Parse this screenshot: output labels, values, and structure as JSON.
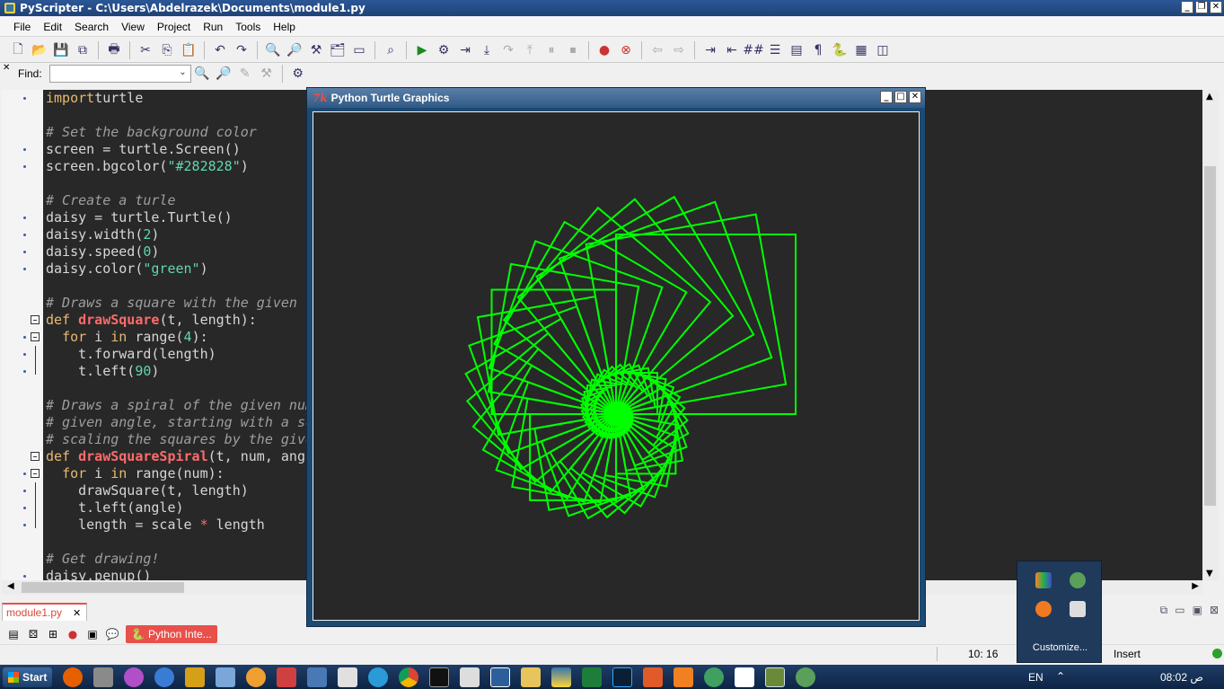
{
  "window": {
    "title": "PyScripter - C:\\Users\\Abdelrazek\\Documents\\module1.py"
  },
  "menu": [
    "File",
    "Edit",
    "Search",
    "View",
    "Project",
    "Run",
    "Tools",
    "Help"
  ],
  "findbar": {
    "label": "Find:",
    "value": ""
  },
  "editor": {
    "lines": [
      [
        [
          "imp",
          "import"
        ],
        [
          "",
          "turtle"
        ]
      ],
      [],
      [
        [
          "cm",
          "# Set the background color"
        ]
      ],
      [
        [
          "",
          "screen = turtle.Screen()"
        ]
      ],
      [
        [
          "",
          "screen.bgcolor("
        ],
        [
          "st",
          "\"#282828\""
        ],
        [
          "",
          ")"
        ]
      ],
      [],
      [
        [
          "cm",
          "# Create a turle"
        ]
      ],
      [
        [
          "",
          "daisy = turtle.Turtle()"
        ]
      ],
      [
        [
          "",
          "daisy.width("
        ],
        [
          "nm",
          "2"
        ],
        [
          "",
          ")"
        ]
      ],
      [
        [
          "",
          "daisy.speed("
        ],
        [
          "nm",
          "0"
        ],
        [
          "",
          ")"
        ]
      ],
      [
        [
          "",
          "daisy.color("
        ],
        [
          "st",
          "\"green\""
        ],
        [
          "",
          ")"
        ]
      ],
      [],
      [
        [
          "cm",
          "# Draws a square with the given l"
        ]
      ],
      [
        [
          "kw",
          "def"
        ],
        [
          "",
          " "
        ],
        [
          "fn",
          "drawSquare"
        ],
        [
          "",
          "(t, length):"
        ]
      ],
      [
        [
          "",
          "  "
        ],
        [
          "kw",
          "for"
        ],
        [
          "",
          " i "
        ],
        [
          "kw",
          "in"
        ],
        [
          "",
          " range("
        ],
        [
          "nm",
          "4"
        ],
        [
          "",
          "):"
        ]
      ],
      [
        [
          "",
          "    t.forward(length)"
        ]
      ],
      [
        [
          "",
          "    t.left("
        ],
        [
          "nm",
          "90"
        ],
        [
          "",
          ")"
        ]
      ],
      [],
      [
        [
          "cm",
          "# Draws a spiral of the given num"
        ]
      ],
      [
        [
          "cm",
          "# given angle, starting with a sq"
        ]
      ],
      [
        [
          "cm",
          "# scaling the squares by the give"
        ]
      ],
      [
        [
          "kw",
          "def"
        ],
        [
          "",
          " "
        ],
        [
          "fn",
          "drawSquareSpiral"
        ],
        [
          "",
          "(t, num, angl"
        ]
      ],
      [
        [
          "",
          "  "
        ],
        [
          "kw",
          "for"
        ],
        [
          "",
          " i "
        ],
        [
          "kw",
          "in"
        ],
        [
          "",
          " range(num):"
        ]
      ],
      [
        [
          "",
          "    drawSquare(t, length)"
        ]
      ],
      [
        [
          "",
          "    t.left(angle)"
        ]
      ],
      [
        [
          "",
          "    length = scale "
        ],
        [
          "op",
          "*"
        ],
        [
          "",
          " length"
        ]
      ],
      [],
      [
        [
          "cm",
          "# Get drawing!"
        ]
      ],
      [
        [
          "",
          "daisy.penup()"
        ]
      ]
    ]
  },
  "tabs": {
    "active": "module1.py"
  },
  "panel": {
    "python_tab": "Python Inte..."
  },
  "status": {
    "position": "10: 16",
    "mode": "Insert"
  },
  "turtle_window": {
    "title": "Python Turtle Graphics",
    "icon_text": "7k",
    "background": "#282828",
    "stroke_color": "#00ff00"
  },
  "tray_flyout": {
    "customize": "Customize..."
  },
  "taskbar": {
    "start": "Start",
    "language": "EN",
    "clock": "08:02 ص"
  },
  "colors": {
    "accent": "#e8504a",
    "titlebar": "#2b5797"
  }
}
